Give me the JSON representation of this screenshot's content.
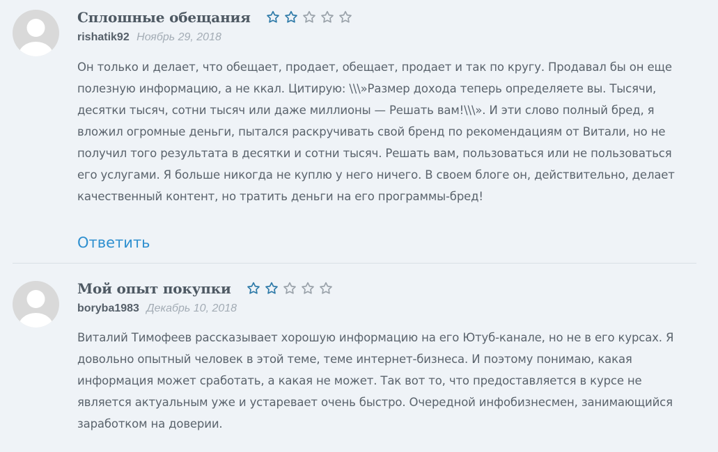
{
  "colors": {
    "background": "#eff3f7",
    "star_filled": "#2e7aa8",
    "star_empty": "#9aa2aa",
    "reply_link": "#2e8fcf",
    "date": "#a3acb5"
  },
  "reviews": [
    {
      "title": "Сплошные обещания",
      "rating": 2,
      "rating_max": 5,
      "author": "rishatik92",
      "date": "Ноябрь 29, 2018",
      "text": "Он только и делает, что обещает, продает, обещает, продает и так по кругу. Продавал бы он еще полезную информацию, а не ккал. Цитирую: \\\\\\»Размер дохода теперь определяете вы. Тысячи, десятки тысяч, сотни тысяч или даже миллионы — Решать вам!\\\\\\». И эти слово полный бред, я вложил огромные деньги, пытался раскручивать свой бренд по рекомендациям от Витали, но не получил того результата в десятки и сотни тысяч. Решать вам, пользоваться или не пользоваться его услугами. Я больше никогда не куплю у него ничего. В своем блоге он, действительно, делает качественный контент, но тратить деньги на его программы-бред!",
      "reply_label": "Ответить"
    },
    {
      "title": "Мой опыт покупки",
      "rating": 2,
      "rating_max": 5,
      "author": "boryba1983",
      "date": "Декабрь 10, 2018",
      "text": "Виталий Тимофеев рассказывает хорошую информацию на его Ютуб-канале, но не в его курсах. Я довольно опытный человек в этой теме, теме интернет-бизнеса. И поэтому понимаю, какая информация может сработать, а какая не может. Так вот то, что предоставляется в курсе не является актуальным уже и устаревает очень быстро. Очередной инфобизнесмен, занимающийся заработком на доверии."
    }
  ]
}
